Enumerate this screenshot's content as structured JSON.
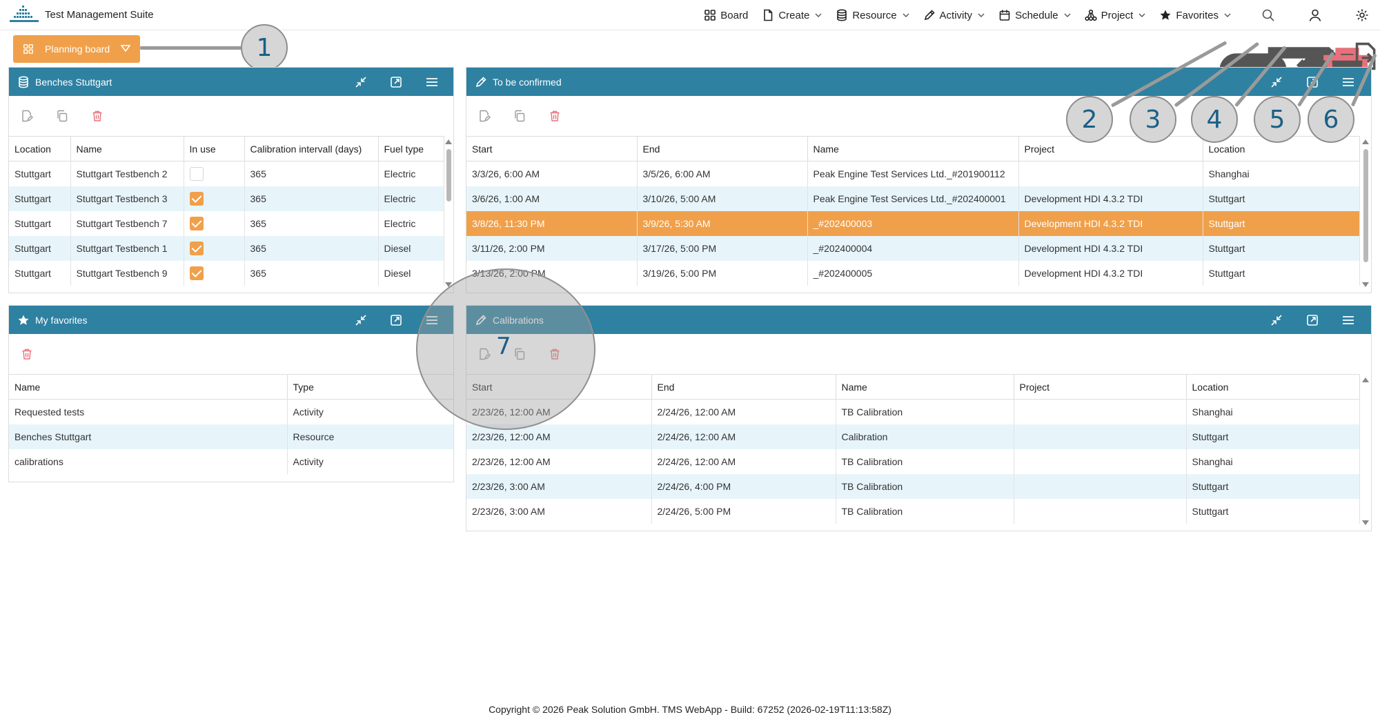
{
  "app": {
    "title": "Test Management Suite"
  },
  "nav": {
    "board": "Board",
    "create": "Create",
    "resource": "Resource",
    "activity": "Activity",
    "schedule": "Schedule",
    "project": "Project",
    "favorites": "Favorites"
  },
  "board_button": {
    "label": "Planning board"
  },
  "callouts": [
    "1",
    "2",
    "3",
    "4",
    "5",
    "6",
    "7"
  ],
  "panels": {
    "benches": {
      "title": "Benches Stuttgart",
      "columns": [
        "Location",
        "Name",
        "In use",
        "Calibration intervall (days)",
        "Fuel type"
      ],
      "rows": [
        {
          "location": "Stuttgart",
          "name": "Stuttgart Testbench 2",
          "in_use": false,
          "interval": "365",
          "fuel": "Electric"
        },
        {
          "location": "Stuttgart",
          "name": "Stuttgart Testbench 3",
          "in_use": true,
          "interval": "365",
          "fuel": "Electric"
        },
        {
          "location": "Stuttgart",
          "name": "Stuttgart Testbench 7",
          "in_use": true,
          "interval": "365",
          "fuel": "Electric"
        },
        {
          "location": "Stuttgart",
          "name": "Stuttgart Testbench 1",
          "in_use": true,
          "interval": "365",
          "fuel": "Diesel"
        },
        {
          "location": "Stuttgart",
          "name": "Stuttgart Testbench 9",
          "in_use": true,
          "interval": "365",
          "fuel": "Diesel"
        }
      ]
    },
    "confirm": {
      "title": "To be confirmed",
      "columns": [
        "Start",
        "End",
        "Name",
        "Project",
        "Location"
      ],
      "rows": [
        {
          "start": "3/3/26, 6:00 AM",
          "end": "3/5/26, 6:00 AM",
          "name": "Peak Engine Test Services Ltd._#201900112",
          "project": "",
          "location": "Shanghai"
        },
        {
          "start": "3/6/26, 1:00 AM",
          "end": "3/10/26, 5:00 AM",
          "name": "Peak Engine Test Services Ltd._#202400001",
          "project": "Development HDI 4.3.2 TDI",
          "location": "Stuttgart"
        },
        {
          "start": "3/8/26, 11:30 PM",
          "end": "3/9/26, 5:30 AM",
          "name": "_#202400003",
          "project": "Development HDI 4.3.2 TDI",
          "location": "Stuttgart"
        },
        {
          "start": "3/11/26, 2:00 PM",
          "end": "3/17/26, 5:00 PM",
          "name": "_#202400004",
          "project": "Development HDI 4.3.2 TDI",
          "location": "Stuttgart"
        },
        {
          "start": "3/13/26, 2:00 PM",
          "end": "3/19/26, 5:00 PM",
          "name": "_#202400005",
          "project": "Development HDI 4.3.2 TDI",
          "location": "Stuttgart"
        }
      ]
    },
    "favorites": {
      "title": "My favorites",
      "columns": [
        "Name",
        "Type"
      ],
      "rows": [
        {
          "name": "Requested tests",
          "type": "Activity"
        },
        {
          "name": "Benches Stuttgart",
          "type": "Resource"
        },
        {
          "name": "calibrations",
          "type": "Activity"
        }
      ]
    },
    "calibrations": {
      "title": "Calibrations",
      "columns": [
        "Start",
        "End",
        "Name",
        "Project",
        "Location"
      ],
      "rows": [
        {
          "start": "2/23/26, 12:00 AM",
          "end": "2/24/26, 12:00 AM",
          "name": "TB Calibration",
          "project": "",
          "location": "Shanghai"
        },
        {
          "start": "2/23/26, 12:00 AM",
          "end": "2/24/26, 12:00 AM",
          "name": "Calibration",
          "project": "",
          "location": "Stuttgart"
        },
        {
          "start": "2/23/26, 12:00 AM",
          "end": "2/24/26, 12:00 AM",
          "name": "TB Calibration",
          "project": "",
          "location": "Shanghai"
        },
        {
          "start": "2/23/26, 3:00 AM",
          "end": "2/24/26, 4:00 PM",
          "name": "TB Calibration",
          "project": "",
          "location": "Stuttgart"
        },
        {
          "start": "2/23/26, 3:00 AM",
          "end": "2/24/26, 5:00 PM",
          "name": "TB Calibration",
          "project": "",
          "location": "Stuttgart"
        }
      ]
    }
  },
  "footer": {
    "text": "Copyright © 2026 Peak Solution GmbH. TMS WebApp - Build: 67252 (2026-02-19T11:13:58Z)"
  },
  "colors": {
    "header": "#2e81a1",
    "accent": "#f0a04b",
    "row_alt": "#e7f5fb",
    "callout_text": "#1a5f86"
  }
}
